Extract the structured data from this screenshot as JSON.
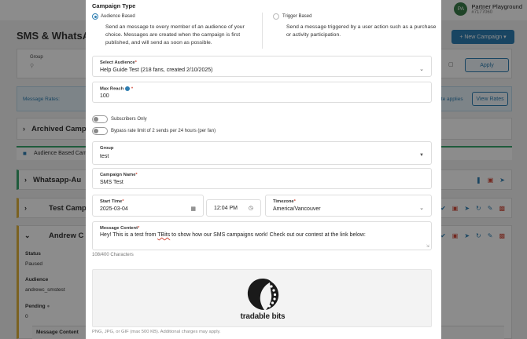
{
  "background": {
    "user": {
      "initials": "PA",
      "name": "Partner Playground",
      "id": "#7177060"
    },
    "page_title": "SMS & WhatsAp",
    "new_campaign_label": "+ New Campaign ▾",
    "filters": {
      "group_label": "Group",
      "apply_label": "Apply"
    },
    "rates": {
      "label": "Message Rates:",
      "applies_text": "rate applies",
      "view_rates_label": "View Rates"
    },
    "archived_title": "Archived Campai",
    "section_tab_label": "Audience Based Cam",
    "whatsapp_title": "Whatsapp-Au",
    "test_title": "Test Campai",
    "andrew_title": "Andrew C Te",
    "details": {
      "status_label": "Status",
      "status_value": "Paused",
      "audience_label": "Audience",
      "audience_value": "andrewc_smstest",
      "pending_label": "Pending",
      "pending_value": "0"
    },
    "message_content_header": "Message Content"
  },
  "modal": {
    "section_title": "Campaign Type",
    "audience_option": {
      "title": "Audience Based",
      "description": "Send an message to every member of an audience of your choice. Messages are created when the campaign is first published, and will send as soon as possible.",
      "selected": true
    },
    "trigger_option": {
      "title": "Trigger Based",
      "description": "Send a message triggered by a user action such as a purchase or activity participation.",
      "selected": false
    },
    "select_audience": {
      "label": "Select Audience",
      "value": "Help Guide Test  (218 fans, created 2/10/2025)"
    },
    "max_reach": {
      "label": "Max Reach",
      "value": "100"
    },
    "toggles": {
      "subscribers_only": "Subscribers Only",
      "bypass_rate": "Bypass rate limit of 2 sends per 24 hours (per fan)"
    },
    "group": {
      "label": "Group",
      "value": "test"
    },
    "campaign_name": {
      "label": "Campaign Name",
      "value": "SMS Test"
    },
    "start_time": {
      "label": "Start Time",
      "date": "2025-03-04",
      "time": "12:04 PM"
    },
    "timezone": {
      "label": "Timezone",
      "value": "America/Vancouver"
    },
    "message_content": {
      "label": "Message Content",
      "text_before": "Hey! This is a test from ",
      "text_brand": "TBits",
      "text_after": " to show how our SMS campaigns work! Check out our contest at the link below:"
    },
    "char_count": "108/400 Characters",
    "logo_text": "tradable bits",
    "upload_note": "PNG, JPG, or GIF (max 500 KB). Additional charges may apply."
  },
  "colors": {
    "accent": "#2f7fb2",
    "required": "#d14a3a",
    "green": "#3aa76d",
    "yellow": "#e0b23c"
  }
}
